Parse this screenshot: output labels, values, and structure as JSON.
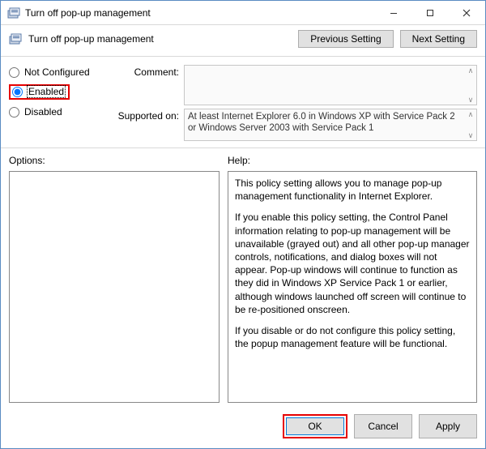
{
  "window": {
    "title": "Turn off pop-up management"
  },
  "header": {
    "title": "Turn off pop-up management",
    "prev_label": "Previous Setting",
    "next_label": "Next Setting"
  },
  "state": {
    "not_configured_label": "Not Configured",
    "enabled_label": "Enabled",
    "disabled_label": "Disabled",
    "selected": "enabled"
  },
  "comment": {
    "label": "Comment:",
    "value": ""
  },
  "supported": {
    "label": "Supported on:",
    "text": "At least Internet Explorer 6.0 in Windows XP with Service Pack 2 or Windows Server 2003 with Service Pack 1"
  },
  "options": {
    "label": "Options:"
  },
  "help": {
    "label": "Help:",
    "p1": "This policy setting allows you to manage pop-up management functionality in Internet Explorer.",
    "p2": "If you enable this policy setting, the Control Panel information relating to pop-up management will be unavailable (grayed out) and all other pop-up manager controls, notifications, and dialog boxes will not appear. Pop-up windows will continue to function as they did in Windows XP Service Pack 1 or earlier, although windows launched off screen will continue to be re-positioned onscreen.",
    "p3": "If you disable or do not configure this policy setting, the popup management feature will be functional."
  },
  "footer": {
    "ok": "OK",
    "cancel": "Cancel",
    "apply": "Apply"
  }
}
